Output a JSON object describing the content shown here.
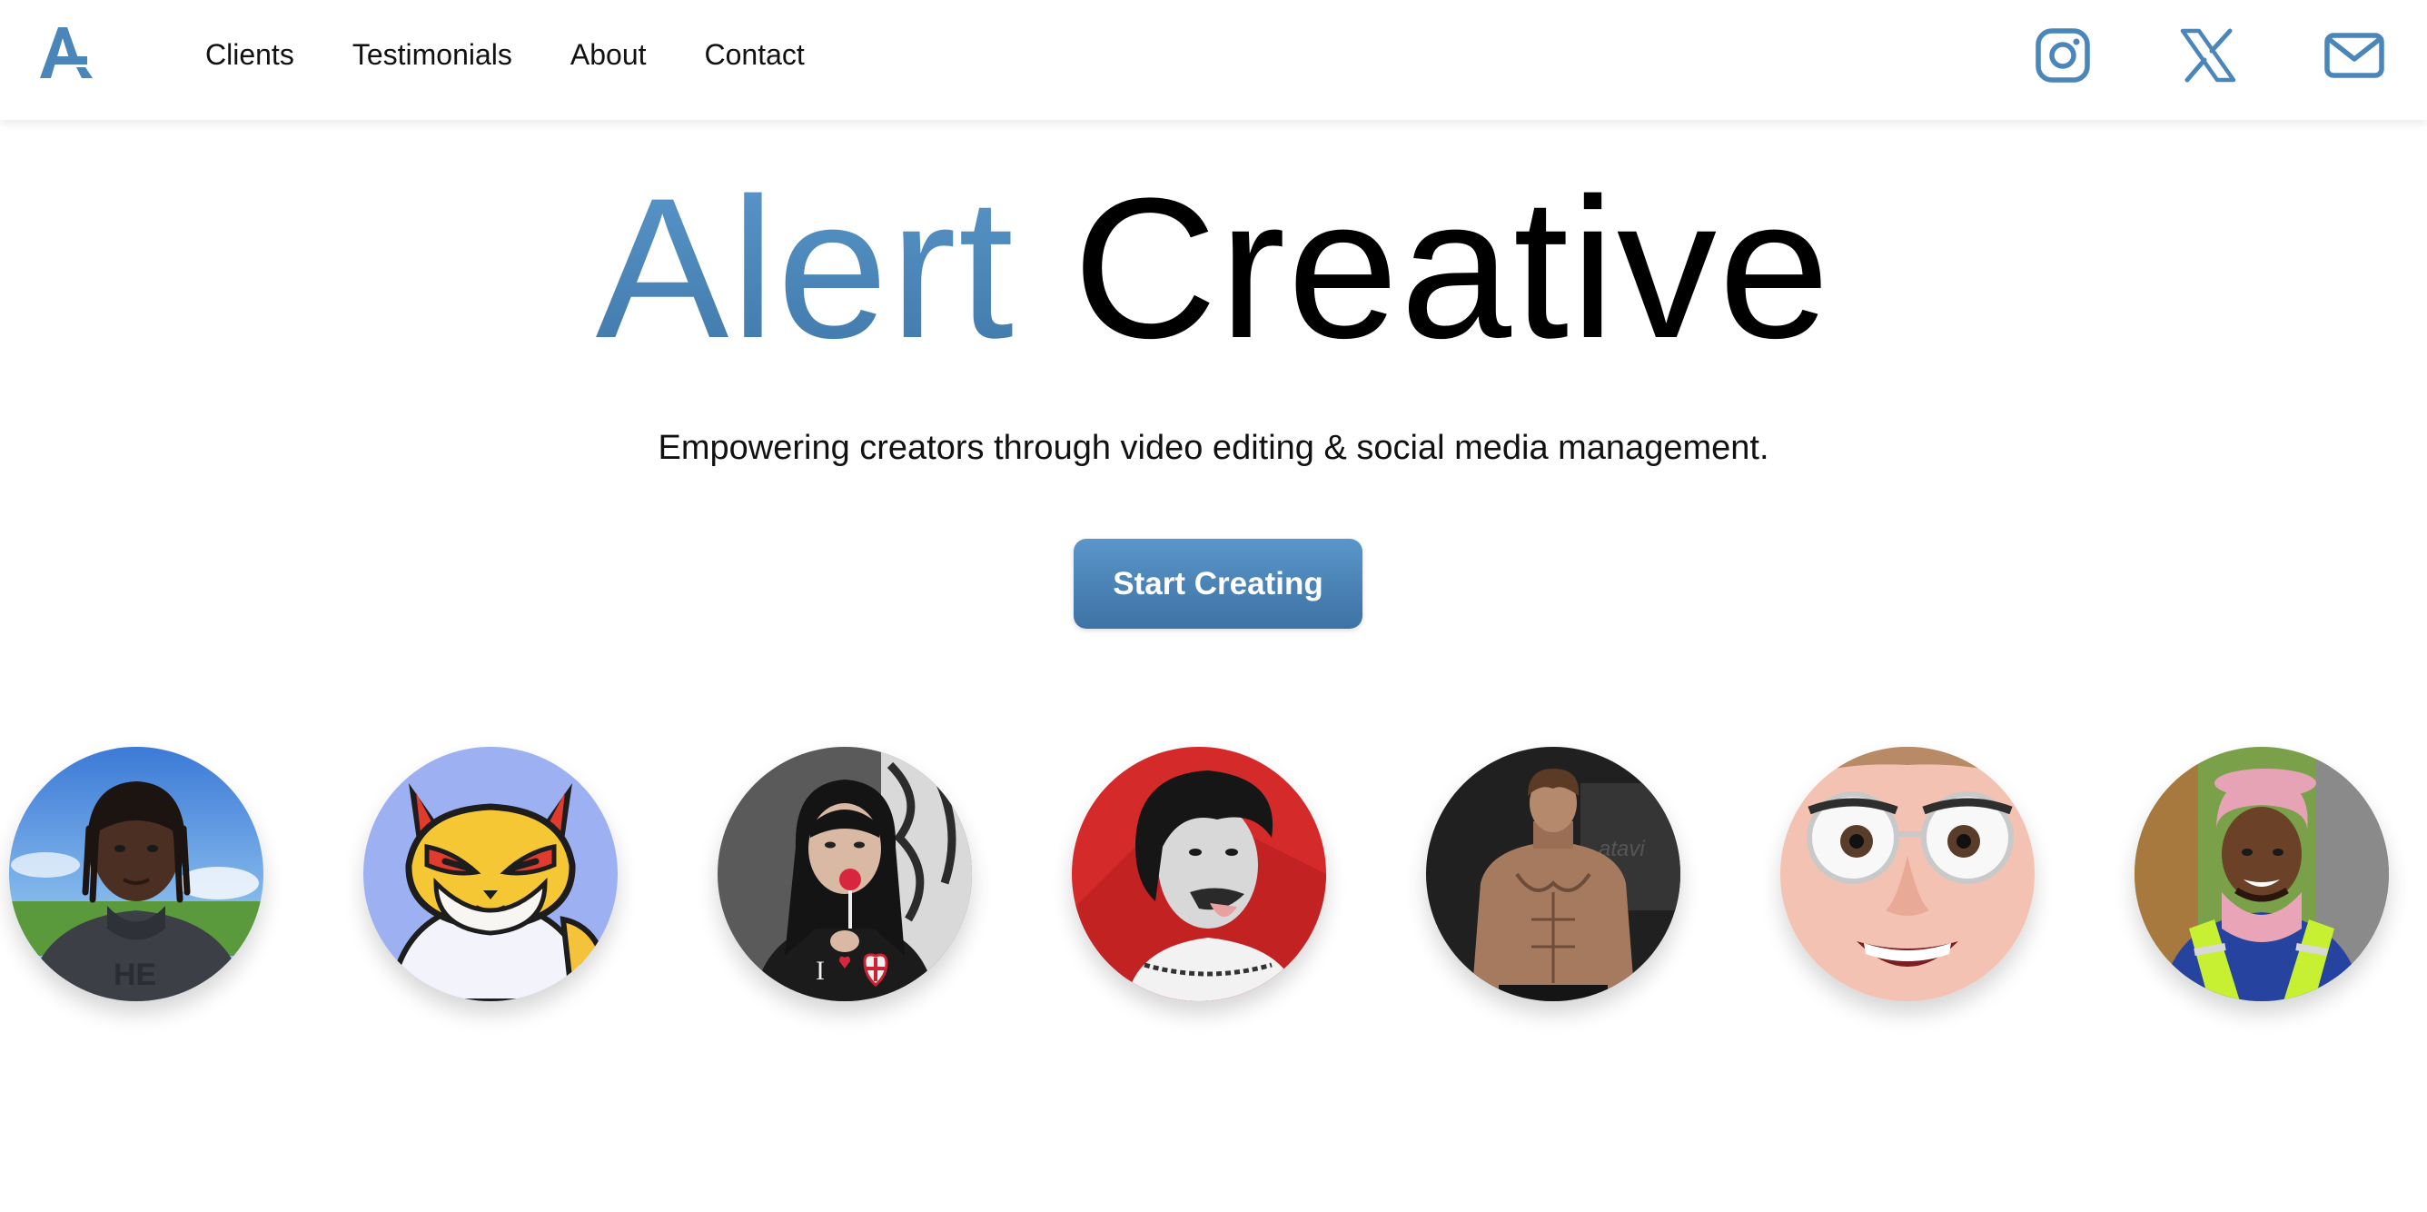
{
  "brand": {
    "logo_icon": "alert-creative-logo-icon",
    "accent_color": "#4a86ba"
  },
  "nav": {
    "links": [
      "Clients",
      "Testimonials",
      "About",
      "Contact"
    ]
  },
  "social": [
    {
      "icon": "instagram-icon"
    },
    {
      "icon": "x-icon"
    },
    {
      "icon": "mail-icon"
    }
  ],
  "hero": {
    "title_accent": "Alert",
    "title_main": "Creative",
    "tagline": "Empowering creators through video editing & social media management.",
    "cta_label": "Start Creating"
  },
  "clients": [
    {
      "avatar": "client-avatar-1"
    },
    {
      "avatar": "client-avatar-2"
    },
    {
      "avatar": "client-avatar-3"
    },
    {
      "avatar": "client-avatar-4"
    },
    {
      "avatar": "client-avatar-5"
    },
    {
      "avatar": "client-avatar-6"
    },
    {
      "avatar": "client-avatar-7"
    }
  ]
}
